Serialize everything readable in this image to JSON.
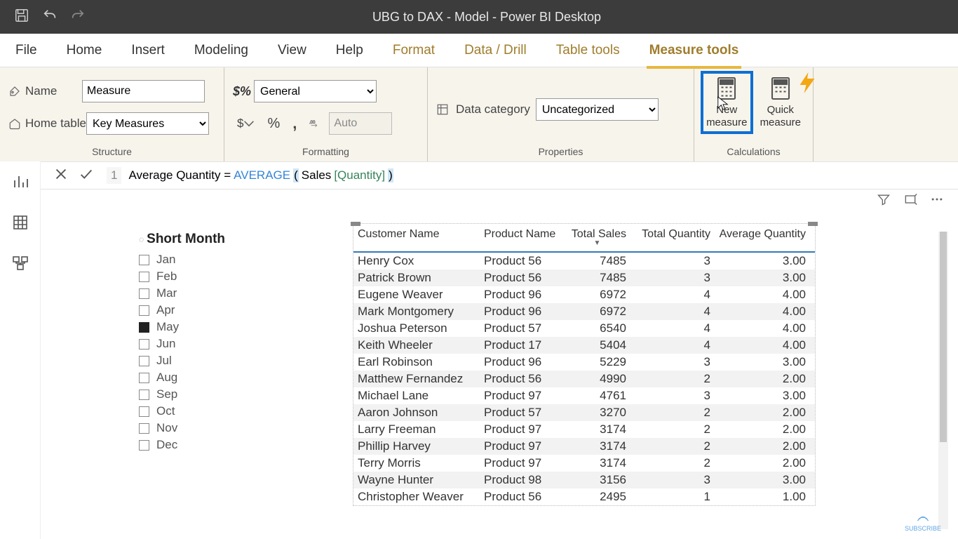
{
  "titlebar": {
    "title": "UBG to DAX - Model - Power BI Desktop"
  },
  "tabs": {
    "file": "File",
    "home": "Home",
    "insert": "Insert",
    "modeling": "Modeling",
    "view": "View",
    "help": "Help",
    "format": "Format",
    "datadrill": "Data / Drill",
    "tabletools": "Table tools",
    "measuretools": "Measure tools"
  },
  "ribbon": {
    "structure": {
      "label": "Structure",
      "name_label": "Name",
      "name_value": "Measure",
      "hometable_label": "Home table",
      "hometable_value": "Key Measures"
    },
    "formatting": {
      "label": "Formatting",
      "format_value": "General",
      "auto": "Auto"
    },
    "properties": {
      "label": "Properties",
      "datacat_label": "Data category",
      "datacat_value": "Uncategorized"
    },
    "calculations": {
      "label": "Calculations",
      "newmeasure": "New measure",
      "quickmeasure": "Quick measure"
    }
  },
  "formula": {
    "line": "1",
    "pre": "Average Quantity = ",
    "fn": "AVERAGE",
    "open": "(",
    "table": " Sales",
    "col": "[Quantity] ",
    "close": ")"
  },
  "slicer": {
    "title": "Short Month",
    "items": [
      {
        "label": "Jan",
        "checked": false
      },
      {
        "label": "Feb",
        "checked": false
      },
      {
        "label": "Mar",
        "checked": false
      },
      {
        "label": "Apr",
        "checked": false
      },
      {
        "label": "May",
        "checked": true
      },
      {
        "label": "Jun",
        "checked": false
      },
      {
        "label": "Jul",
        "checked": false
      },
      {
        "label": "Aug",
        "checked": false
      },
      {
        "label": "Sep",
        "checked": false
      },
      {
        "label": "Oct",
        "checked": false
      },
      {
        "label": "Nov",
        "checked": false
      },
      {
        "label": "Dec",
        "checked": false
      }
    ]
  },
  "table": {
    "headers": [
      "Customer Name",
      "Product Name",
      "Total Sales",
      "Total Quantity",
      "Average Quantity"
    ],
    "rows": [
      {
        "c0": "Henry Cox",
        "c1": "Product 56",
        "c2": "7485",
        "c3": "3",
        "c4": "3.00"
      },
      {
        "c0": "Patrick Brown",
        "c1": "Product 56",
        "c2": "7485",
        "c3": "3",
        "c4": "3.00"
      },
      {
        "c0": "Eugene Weaver",
        "c1": "Product 96",
        "c2": "6972",
        "c3": "4",
        "c4": "4.00"
      },
      {
        "c0": "Mark Montgomery",
        "c1": "Product 96",
        "c2": "6972",
        "c3": "4",
        "c4": "4.00"
      },
      {
        "c0": "Joshua Peterson",
        "c1": "Product 57",
        "c2": "6540",
        "c3": "4",
        "c4": "4.00"
      },
      {
        "c0": "Keith Wheeler",
        "c1": "Product 17",
        "c2": "5404",
        "c3": "4",
        "c4": "4.00"
      },
      {
        "c0": "Earl Robinson",
        "c1": "Product 96",
        "c2": "5229",
        "c3": "3",
        "c4": "3.00"
      },
      {
        "c0": "Matthew Fernandez",
        "c1": "Product 56",
        "c2": "4990",
        "c3": "2",
        "c4": "2.00"
      },
      {
        "c0": "Michael Lane",
        "c1": "Product 97",
        "c2": "4761",
        "c3": "3",
        "c4": "3.00"
      },
      {
        "c0": "Aaron Johnson",
        "c1": "Product 57",
        "c2": "3270",
        "c3": "2",
        "c4": "2.00"
      },
      {
        "c0": "Larry Freeman",
        "c1": "Product 97",
        "c2": "3174",
        "c3": "2",
        "c4": "2.00"
      },
      {
        "c0": "Phillip Harvey",
        "c1": "Product 97",
        "c2": "3174",
        "c3": "2",
        "c4": "2.00"
      },
      {
        "c0": "Terry Morris",
        "c1": "Product 97",
        "c2": "3174",
        "c3": "2",
        "c4": "2.00"
      },
      {
        "c0": "Wayne Hunter",
        "c1": "Product 98",
        "c2": "3156",
        "c3": "3",
        "c4": "3.00"
      },
      {
        "c0": "Christopher Weaver",
        "c1": "Product 56",
        "c2": "2495",
        "c3": "1",
        "c4": "1.00"
      }
    ]
  },
  "subscribe": "SUBSCRIBE"
}
